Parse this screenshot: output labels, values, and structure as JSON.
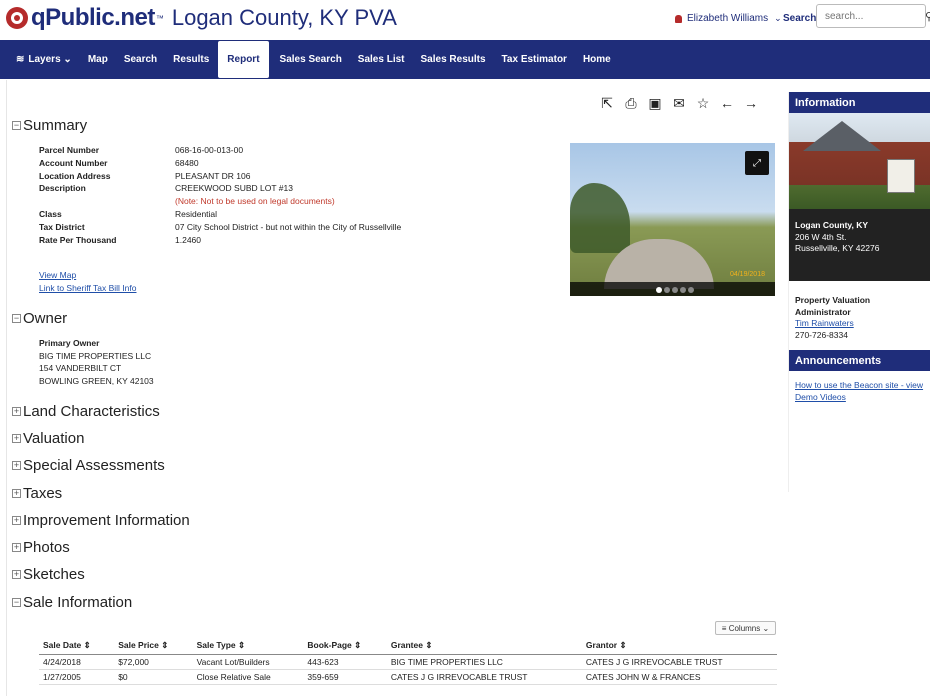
{
  "header": {
    "brand": "qPublic.net",
    "tm": "™",
    "county": "Logan County, KY PVA",
    "user": "Elizabeth Williams",
    "search_label": "Search",
    "search_placeholder": "search..."
  },
  "nav": {
    "items": [
      "Layers",
      "Map",
      "Search",
      "Results",
      "Report",
      "Sales Search",
      "Sales List",
      "Sales Results",
      "Tax Estimator",
      "Home"
    ],
    "active": "Report"
  },
  "toolbar": [
    "share-icon",
    "print-icon",
    "image-icon",
    "email-icon",
    "star-icon",
    "arrow-left-icon",
    "arrow-right-icon"
  ],
  "summary": {
    "title": "Summary",
    "rows": [
      {
        "key": "Parcel Number",
        "value": "068-16-00-013-00"
      },
      {
        "key": "Account Number",
        "value": "68480"
      },
      {
        "key": "Location Address",
        "value": "PLEASANT DR 106"
      },
      {
        "key": "Description",
        "value": "CREEKWOOD SUBD LOT #13"
      },
      {
        "key": "Class",
        "value": "Residential"
      },
      {
        "key": "Tax District",
        "value": "07 City School District - but not within the City of Russellville"
      },
      {
        "key": "Rate Per Thousand",
        "value": "1.2460"
      }
    ],
    "description_note": "(Note: Not to be used on legal documents)",
    "links": [
      "View Map",
      "Link to Sheriff Tax Bill Info"
    ]
  },
  "owner": {
    "title": "Owner",
    "label": "Primary Owner",
    "lines": [
      "BIG TIME PROPERTIES LLC",
      "154 VANDERBILT CT",
      "BOWLING GREEN, KY 42103"
    ]
  },
  "collapsed_sections": [
    "Land Characteristics",
    "Valuation",
    "Special Assessments",
    "Taxes",
    "Improvement Information",
    "Photos",
    "Sketches"
  ],
  "sale": {
    "title": "Sale Information",
    "columns_label": "Columns",
    "headers": [
      "Sale Date",
      "Sale Price",
      "Sale Type",
      "Book-Page",
      "Grantee",
      "Grantor"
    ],
    "rows": [
      [
        "4/24/2018",
        "$72,000",
        "Vacant Lot/Builders",
        "443-623",
        "BIG TIME PROPERTIES LLC",
        "CATES J G IRREVOCABLE TRUST"
      ],
      [
        "1/27/2005",
        "$0",
        "Close Relative Sale",
        "359-659",
        "CATES J G IRREVOCABLE TRUST",
        "CATES JOHN W & FRANCES"
      ]
    ]
  },
  "photo": {
    "stamp": "04/19/2018"
  },
  "sidebar": {
    "info_title": "Information",
    "address_lines": [
      "Logan County, KY",
      "206 W 4th St.",
      "Russellville, KY 42276"
    ],
    "pva_title_1": "Property Valuation",
    "pva_title_2": "Administrator",
    "pva_name": "Tim Rainwaters",
    "pva_phone": "270-726-8334",
    "ann_title": "Announcements",
    "ann_link": "How to use the Beacon site - view Demo Videos"
  }
}
